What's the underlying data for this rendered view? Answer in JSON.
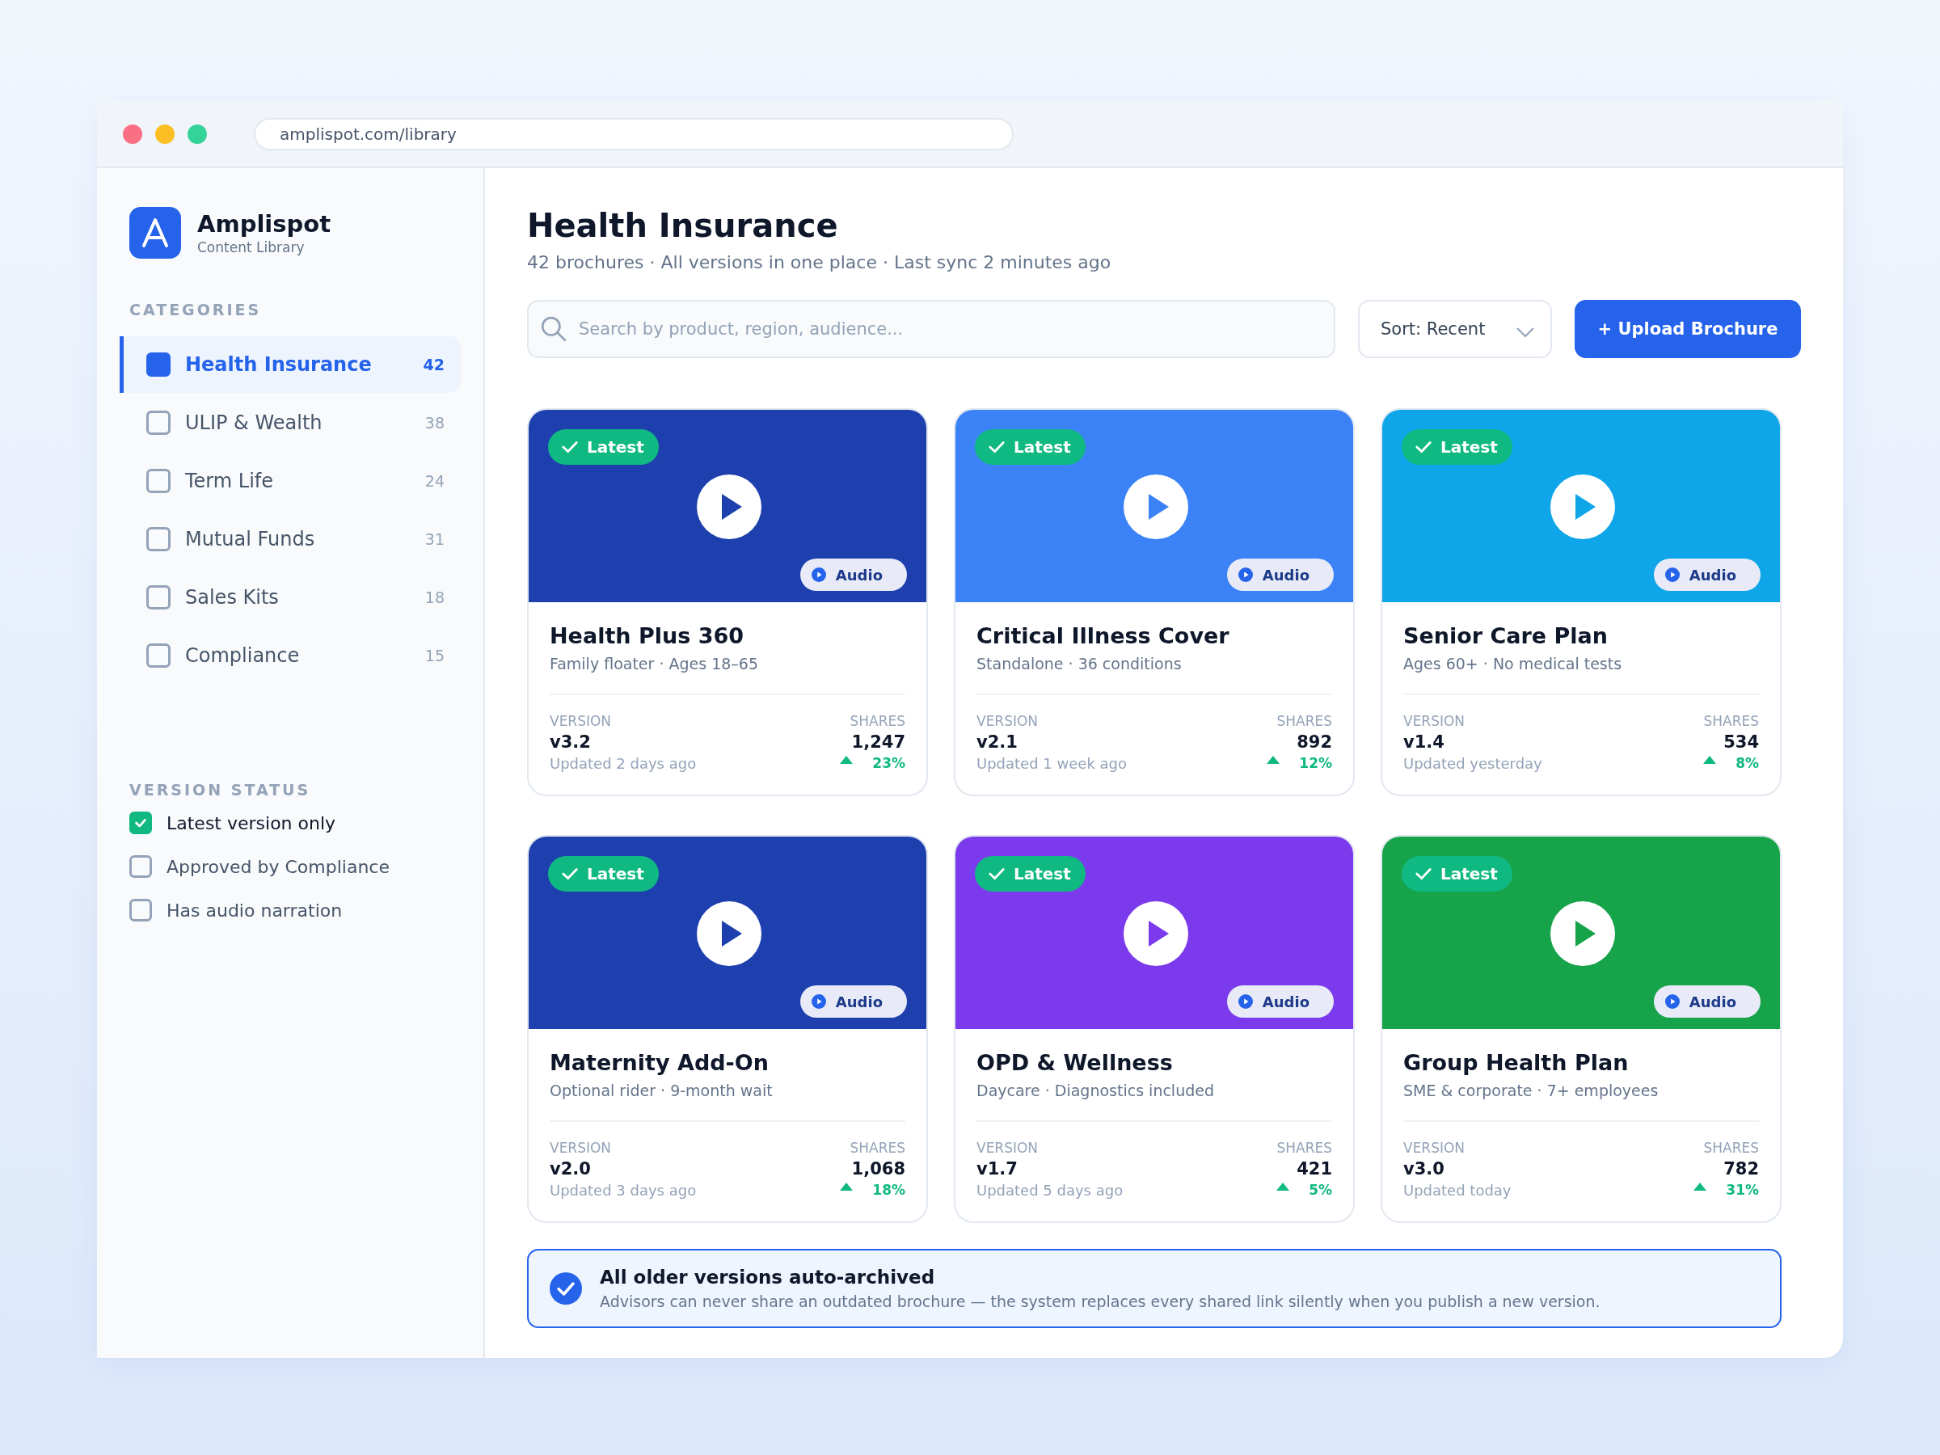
{
  "browser": {
    "url": "amplispot.com/library"
  },
  "brand": {
    "name": "Amplispot",
    "tagline": "Content Library"
  },
  "categories": {
    "heading": "CATEGORIES",
    "items": [
      {
        "label": "Health Insurance",
        "count": "42",
        "selected": true
      },
      {
        "label": "ULIP & Wealth",
        "count": "38",
        "selected": false
      },
      {
        "label": "Term Life",
        "count": "24",
        "selected": false
      },
      {
        "label": "Mutual Funds",
        "count": "31",
        "selected": false
      },
      {
        "label": "Sales Kits",
        "count": "18",
        "selected": false
      },
      {
        "label": "Compliance",
        "count": "15",
        "selected": false
      }
    ]
  },
  "version_status": {
    "heading": "VERSION STATUS",
    "items": [
      {
        "label": "Latest version only",
        "checked": true
      },
      {
        "label": "Approved by Compliance",
        "checked": false
      },
      {
        "label": "Has audio narration",
        "checked": false
      }
    ]
  },
  "header": {
    "title": "Health Insurance",
    "subtitle": "42 brochures · All versions in one place · Last sync 2 minutes ago"
  },
  "toolbar": {
    "search_placeholder": "Search by product, region, audience...",
    "sort": "Sort: Recent",
    "upload_button": "+ Upload Brochure"
  },
  "cards": [
    {
      "color": "#1e40af",
      "badge": "Latest",
      "latest": true,
      "audio": "Audio",
      "title": "Health Plus 360",
      "subtitle": "Family floater · Ages 18–65",
      "version_label": "VERSION",
      "version": "v3.2",
      "updated": "Updated 2 days ago",
      "shares_label": "SHARES",
      "shares": "1,247",
      "change": "23%"
    },
    {
      "color": "#3b82f6",
      "badge": "Latest",
      "latest": true,
      "audio": "Audio",
      "title": "Critical Illness Cover",
      "subtitle": "Standalone · 36 conditions",
      "version_label": "VERSION",
      "version": "v2.1",
      "updated": "Updated 1 week ago",
      "shares_label": "SHARES",
      "shares": "892",
      "change": "12%"
    },
    {
      "color": "#0ea5e9",
      "badge": "Latest",
      "latest": true,
      "audio": "Audio",
      "title": "Senior Care Plan",
      "subtitle": "Ages 60+ · No medical tests",
      "version_label": "VERSION",
      "version": "v1.4",
      "updated": "Updated yesterday",
      "shares_label": "SHARES",
      "shares": "534",
      "change": "8%"
    },
    {
      "color": "#1e40af",
      "badge": "Latest",
      "latest": true,
      "audio": "Audio",
      "title": "Maternity Add-On",
      "subtitle": "Optional rider · 9-month wait",
      "version_label": "VERSION",
      "version": "v2.0",
      "updated": "Updated 3 days ago",
      "shares_label": "SHARES",
      "shares": "1,068",
      "change": "18%"
    },
    {
      "color": "#7c3aed",
      "badge": "Latest",
      "latest": true,
      "audio": "Audio",
      "title": "OPD & Wellness",
      "subtitle": "Daycare · Diagnostics included",
      "version_label": "VERSION",
      "version": "v1.7",
      "updated": "Updated 5 days ago",
      "shares_label": "SHARES",
      "shares": "421",
      "change": "5%"
    },
    {
      "color": "#16a34a",
      "badge": "Latest",
      "latest": true,
      "audio": "Audio",
      "title": "Group Health Plan",
      "subtitle": "SME & corporate · 7+ employees",
      "version_label": "VERSION",
      "version": "v3.0",
      "updated": "Updated today",
      "shares_label": "SHARES",
      "shares": "782",
      "change": "31%"
    }
  ],
  "notice": {
    "title": "All older versions auto-archived",
    "text": "Advisors can never share an outdated brochure — the system replaces every shared link silently when you publish a new version."
  }
}
